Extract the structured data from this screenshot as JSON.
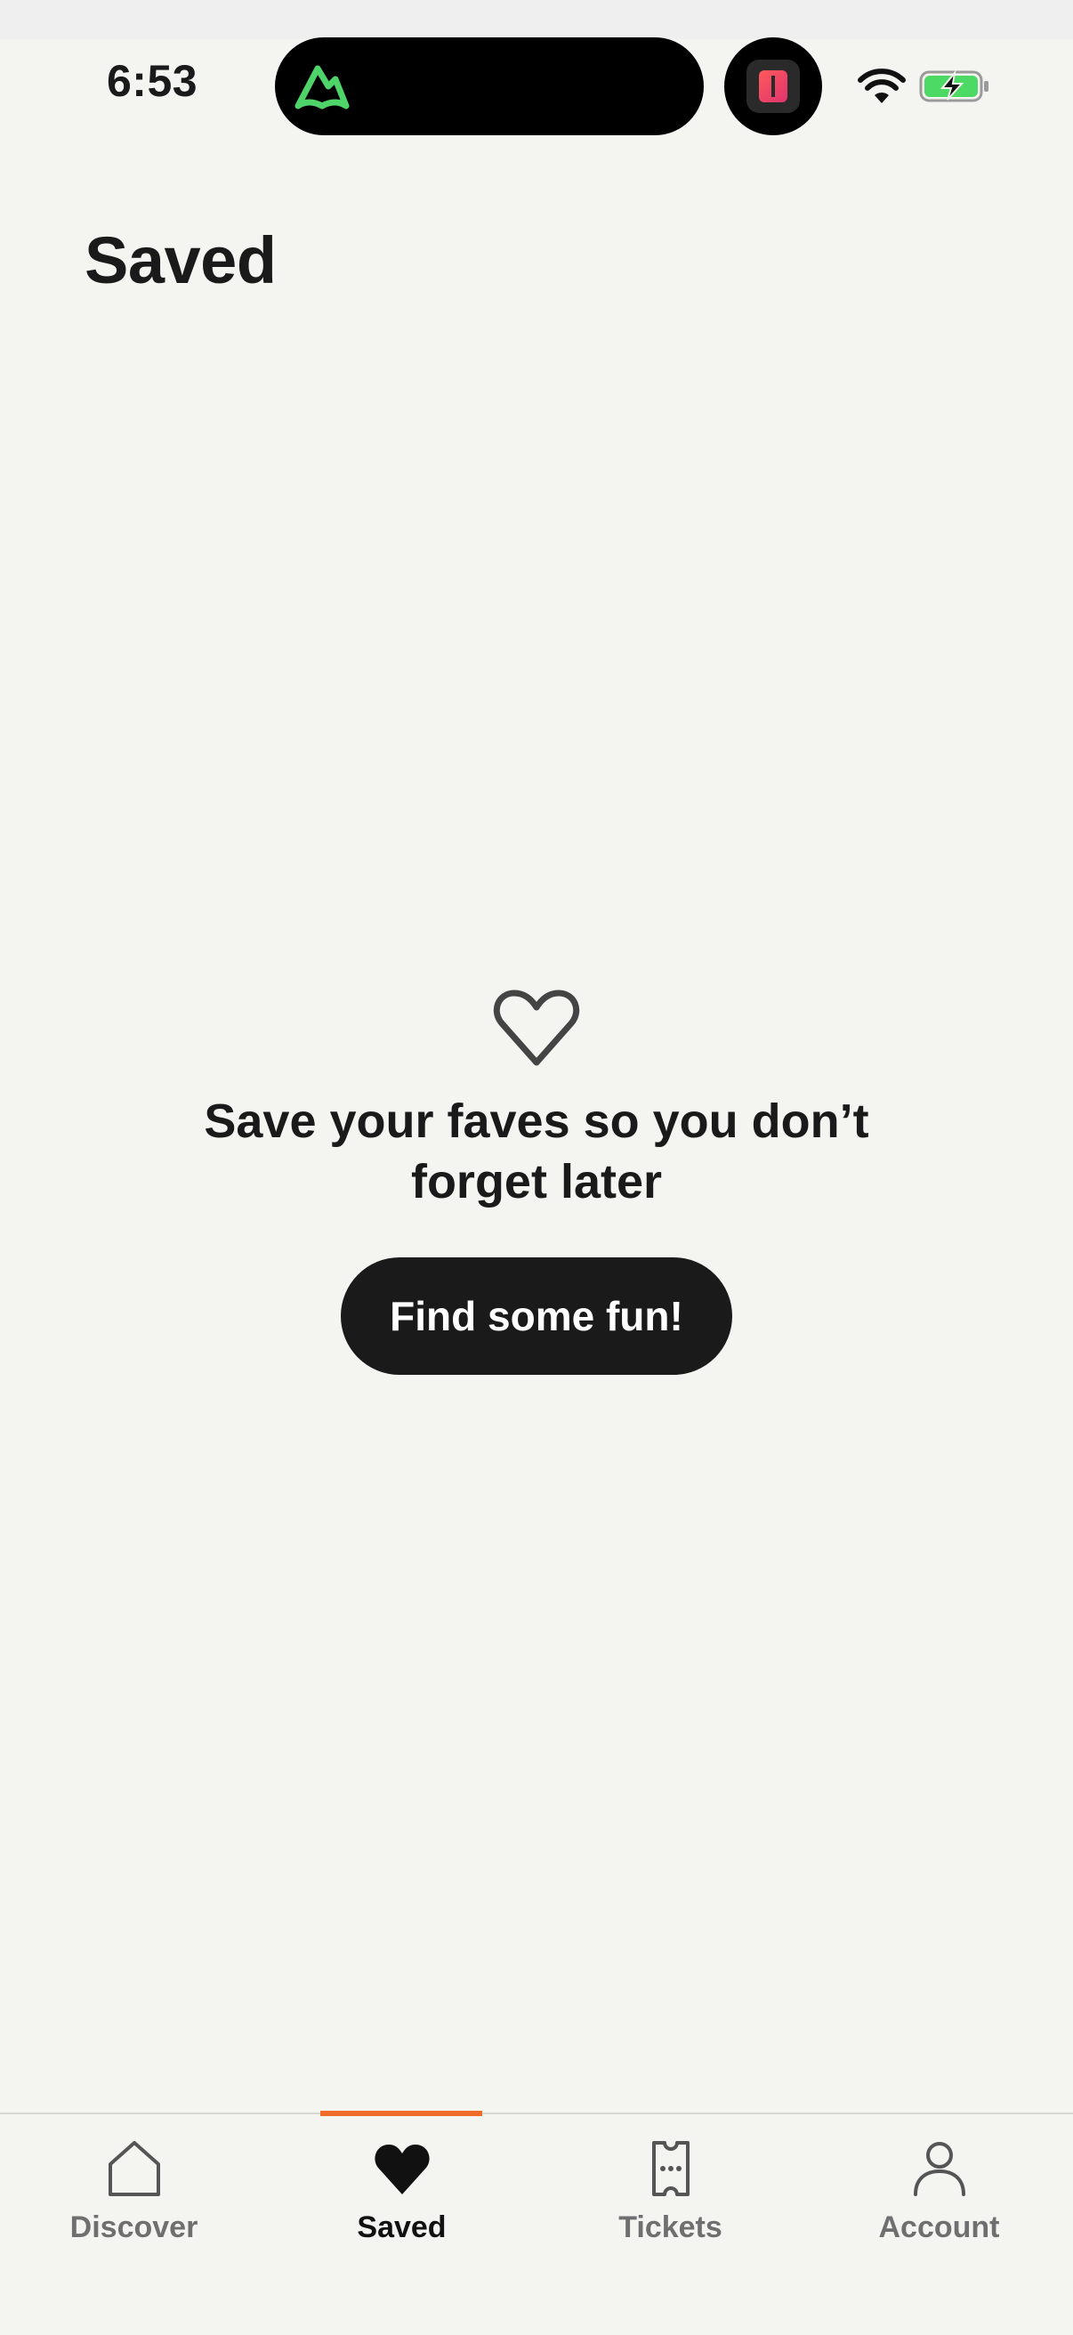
{
  "status_bar": {
    "time": "6:53"
  },
  "header": {
    "title": "Saved"
  },
  "empty_state": {
    "message": "Save your faves so you don’t forget later",
    "cta_label": "Find some fun!"
  },
  "tab_bar": {
    "tabs": [
      {
        "label": "Discover",
        "icon": "home-icon",
        "active": false
      },
      {
        "label": "Saved",
        "icon": "heart-icon",
        "active": true
      },
      {
        "label": "Tickets",
        "icon": "ticket-icon",
        "active": false
      },
      {
        "label": "Account",
        "icon": "person-icon",
        "active": false
      }
    ],
    "active_indicator_color": "#f06a2a"
  },
  "colors": {
    "background": "#f4f4f0",
    "text": "#1a1a1a",
    "button": "#1a1a1a",
    "accent": "#f06a2a",
    "inactive_tab": "#6f6f6f"
  }
}
